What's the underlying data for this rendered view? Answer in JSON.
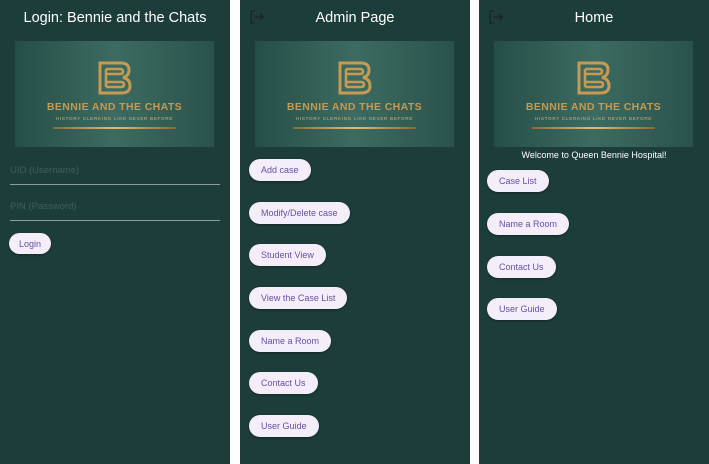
{
  "login": {
    "title": "Login: Bennie and the Chats",
    "uid_placeholder": "UID (Username)",
    "pin_placeholder": "PIN (Password)",
    "login_label": "Login"
  },
  "banner": {
    "name": "BENNIE AND THE CHATS",
    "tagline": "HISTORY CLERKING LIKE NEVER BEFORE"
  },
  "admin": {
    "title": "Admin Page",
    "buttons": [
      "Add case",
      "Modify/Delete case",
      "Student View",
      "View the Case List",
      "Name a Room",
      "Contact Us",
      "User Guide"
    ]
  },
  "home": {
    "title": "Home",
    "welcome": "Welcome to Queen Bennie Hospital!",
    "buttons": [
      "Case List",
      "Name a Room",
      "Contact Us",
      "User Guide"
    ]
  },
  "colors": {
    "background": "#1d3d3a",
    "button_bg": "#f3eef9",
    "button_text": "#6a4fa0",
    "logo_gold": "#c69a52"
  },
  "icons": {
    "logout": "logout-icon",
    "logo": "logo-b-mark"
  }
}
